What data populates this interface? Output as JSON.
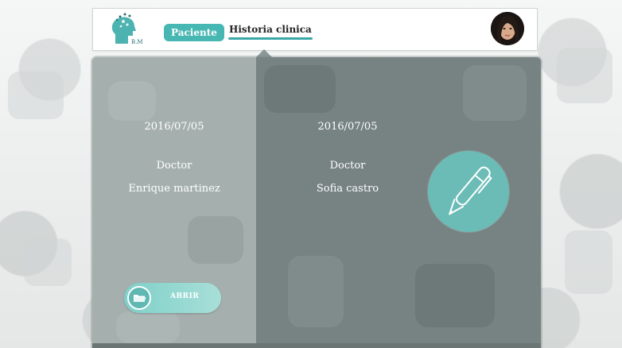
{
  "header": {
    "logo_text": "B.M",
    "tab_paciente": "Paciente",
    "tab_historia": "Historia clinica"
  },
  "cards": [
    {
      "date": "2016/07/05",
      "role": "Doctor",
      "name": "Enrique martinez",
      "button_label": "ABRIR"
    },
    {
      "date": "2016/07/05",
      "role": "Doctor",
      "name": "Sofia castro"
    }
  ],
  "colors": {
    "accent": "#47b7b3",
    "panel_left": "#a8b2b0",
    "panel_right": "#768382"
  },
  "icons": {
    "logo": "brain-head-icon",
    "avatar": "user-avatar",
    "pen": "pen-icon",
    "folder": "folder-icon"
  }
}
